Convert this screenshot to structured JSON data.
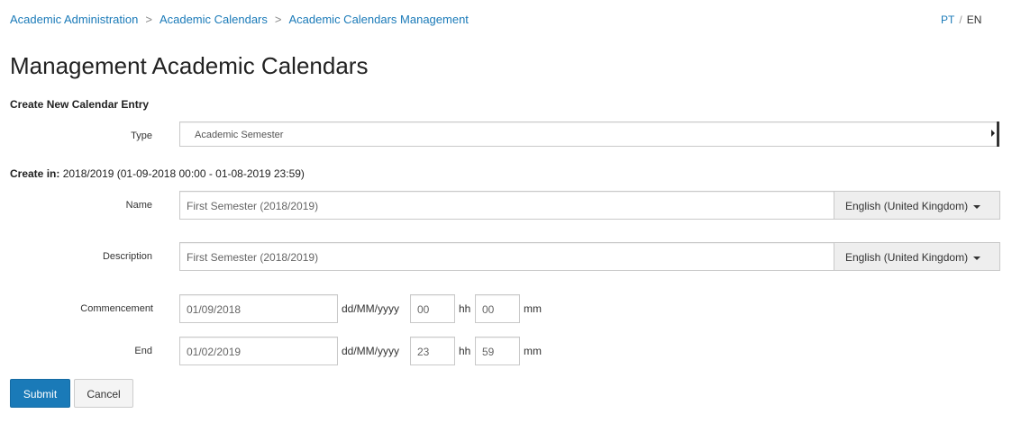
{
  "breadcrumb": {
    "items": [
      "Academic Administration",
      "Academic Calendars",
      "Academic Calendars Management"
    ],
    "separator": ">"
  },
  "language": {
    "pt": "PT",
    "separator": "/",
    "en": "EN"
  },
  "page_title": "Management Academic Calendars",
  "section_title": "Create New Calendar Entry",
  "type_field": {
    "label": "Type",
    "value": "Academic Semester"
  },
  "create_in": {
    "label": "Create in:",
    "value": "2018/2019 (01-09-2018 00:00 - 01-08-2019 23:59)"
  },
  "name_field": {
    "label": "Name",
    "value": "First Semester (2018/2019)",
    "locale": "English (United Kingdom)"
  },
  "description_field": {
    "label": "Description",
    "value": "First Semester (2018/2019)",
    "locale": "English (United Kingdom)"
  },
  "commencement": {
    "label": "Commencement",
    "date": "01/09/2018",
    "date_format": "dd/MM/yyyy",
    "hour": "00",
    "hour_unit": "hh",
    "minute": "00",
    "minute_unit": "mm"
  },
  "end": {
    "label": "End",
    "date": "01/02/2019",
    "date_format": "dd/MM/yyyy",
    "hour": "23",
    "hour_unit": "hh",
    "minute": "59",
    "minute_unit": "mm"
  },
  "buttons": {
    "submit": "Submit",
    "cancel": "Cancel"
  },
  "colors": {
    "link": "#1a7ab8",
    "primary_button": "#1a7ab8",
    "addon_background": "#eeeeee"
  }
}
